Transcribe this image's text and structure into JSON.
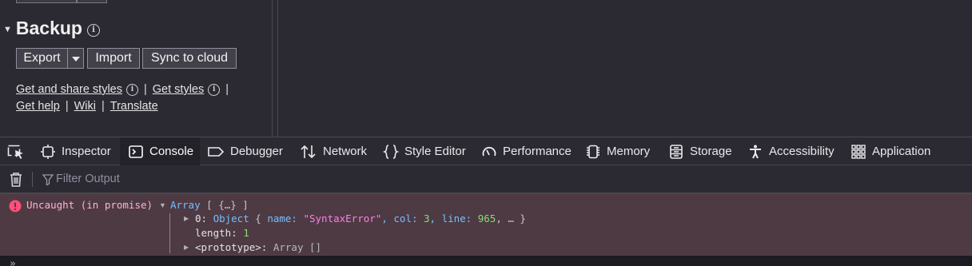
{
  "popup": {
    "backup": {
      "title": "Backup",
      "export_label": "Export",
      "import_label": "Import",
      "sync_label": "Sync to cloud"
    },
    "links": {
      "get_share_styles": "Get and share styles",
      "get_styles": "Get styles",
      "get_help": "Get help",
      "wiki": "Wiki",
      "translate": "Translate",
      "separator": "|"
    }
  },
  "devtools": {
    "tabs": [
      {
        "label": "Inspector",
        "icon": "inspector-icon"
      },
      {
        "label": "Console",
        "icon": "console-icon",
        "active": true
      },
      {
        "label": "Debugger",
        "icon": "debugger-icon"
      },
      {
        "label": "Network",
        "icon": "network-icon"
      },
      {
        "label": "Style Editor",
        "icon": "style-editor-icon"
      },
      {
        "label": "Performance",
        "icon": "performance-icon"
      },
      {
        "label": "Memory",
        "icon": "memory-icon"
      },
      {
        "label": "Storage",
        "icon": "storage-icon"
      },
      {
        "label": "Accessibility",
        "icon": "accessibility-icon"
      },
      {
        "label": "Application",
        "icon": "application-icon"
      }
    ],
    "accent_color": "#0a84ff",
    "console": {
      "filter_placeholder": "Filter Output",
      "error": {
        "text": "Uncaught (in promise)",
        "array_label": "Array",
        "array_preview": "[ {…} ]",
        "row0_key": "0: ",
        "row0_type": "Object",
        "row0_open": " { ",
        "row0_name_key": "name: ",
        "row0_name_val": "\"SyntaxError\"",
        "row0_col_key": ", col: ",
        "row0_col_val": "3",
        "row0_line_key": ", line: ",
        "row0_line_val": "965",
        "row0_tail": ", … }",
        "length_key": "length: ",
        "length_val": "1",
        "proto_key": "<prototype>",
        "proto_sep": ": ",
        "proto_val": "Array []"
      },
      "prompt": "»"
    }
  }
}
